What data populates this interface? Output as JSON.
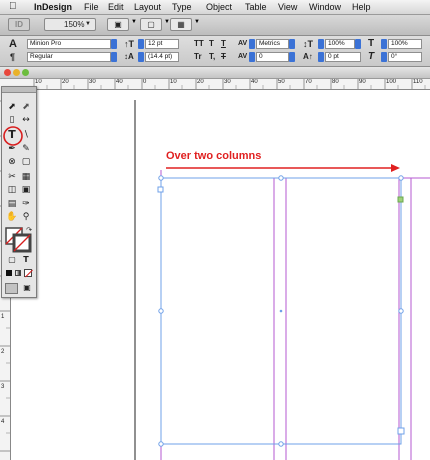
{
  "menubar": {
    "app_name": "InDesign",
    "items": [
      "File",
      "Edit",
      "Layout",
      "Type",
      "Object",
      "Table",
      "View",
      "Window",
      "Help"
    ]
  },
  "appbar": {
    "zoom": "150%"
  },
  "control_panel": {
    "font_family": "Minion Pro",
    "font_style": "Regular",
    "font_size": "12 pt",
    "leading": "(14.4 pt)",
    "kerning": "Metrics",
    "tracking": "0",
    "vertical_scale": "100%",
    "horizontal_scale": "100%",
    "baseline_shift": "0 pt",
    "skew": "0°",
    "caps_buttons": [
      "TT",
      "T",
      "T"
    ],
    "sub_buttons": [
      "Tr",
      "T,",
      "T"
    ]
  },
  "ruler": {
    "h_labels": [
      "0",
      "10",
      "20",
      "30",
      "40",
      "50",
      "60",
      "70",
      "80",
      "90",
      "100",
      "110"
    ],
    "v_labels": [
      "1",
      "2",
      "3",
      "4",
      "5"
    ]
  },
  "annotation": {
    "text": "Over two columns",
    "color": "#e02020"
  },
  "colors": {
    "frame_blue": "#6fa0e8",
    "column_magenta": "#b45ad2",
    "highlight_red": "#d81e1e",
    "stepper_blue": "#3b72d6"
  }
}
